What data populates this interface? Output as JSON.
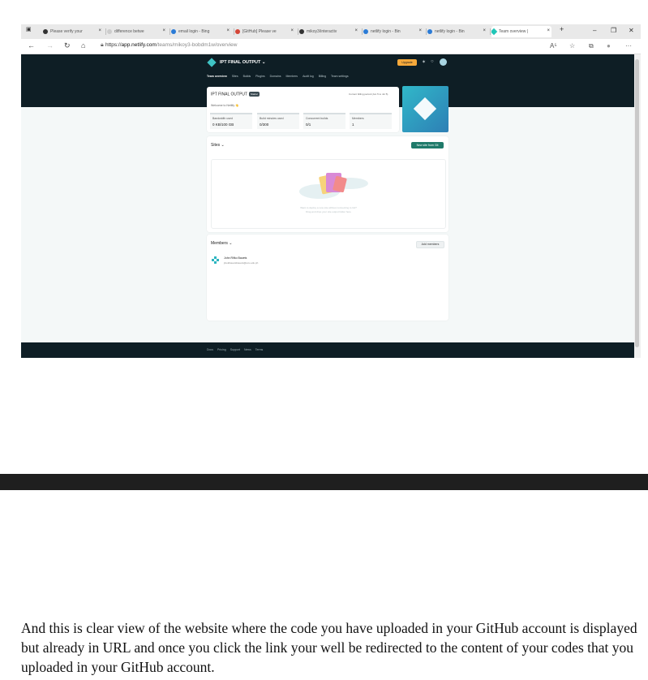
{
  "browser": {
    "tabs": [
      {
        "label": "Please verify your",
        "icon": "github-icon",
        "color": "#333333",
        "active": false
      },
      {
        "label": "difference betwe",
        "icon": "search-icon",
        "color": "#cccccc",
        "active": false
      },
      {
        "label": "email login - Bing",
        "icon": "bing-icon",
        "color": "#2b7bd6",
        "active": false
      },
      {
        "label": "[GitHub] Please ve",
        "icon": "gmail-icon",
        "color": "#d44638",
        "active": false
      },
      {
        "label": "mikoy3/interactiv",
        "icon": "github-icon",
        "color": "#333333",
        "active": false
      },
      {
        "label": "netlify login - Bin",
        "icon": "bing-icon",
        "color": "#2b7bd6",
        "active": false
      },
      {
        "label": "netlify login - Bin",
        "icon": "bing-icon",
        "color": "#2b7bd6",
        "active": false
      },
      {
        "label": "Team overview |",
        "icon": "netlify-icon",
        "color": "#20c6b7",
        "active": true
      }
    ],
    "new_tab": "+",
    "window": {
      "minimize": "–",
      "maximize": "❐",
      "close": "✕"
    },
    "nav": {
      "back": "←",
      "forward": "→",
      "reload": "↻",
      "home": "⌂"
    },
    "url": {
      "prefix": "https://",
      "host": "app.netlify.com",
      "path": "/teams/mikoy3-bobdm1w/overview"
    },
    "toolbar": {
      "read": "A⁵",
      "favorite": "☆",
      "collections": "⧉",
      "profile": "●",
      "more": "···"
    }
  },
  "netlify": {
    "team_name": "IPT FINAL OUTPUT ⌄",
    "upgrade": "Upgrade",
    "header_icons": {
      "notify": "✶",
      "help": "○"
    },
    "nav": [
      "Team overview",
      "Sites",
      "Builds",
      "Plugins",
      "Domains",
      "Members",
      "Audit log",
      "Billing",
      "Team settings"
    ],
    "overview": {
      "title": "IPT FINAL OUTPUT",
      "badge": "Starter",
      "period": "Current billing period (Jun 5 to Jul 5)",
      "welcome": "Welcome to Netlify 👋",
      "stats": [
        {
          "label": "Bandwidth used",
          "value": "0 KB/100 GB"
        },
        {
          "label": "Build minutes used",
          "value": "0/300"
        },
        {
          "label": "Concurrent builds",
          "value": "0/1"
        },
        {
          "label": "Members",
          "value": "1"
        }
      ]
    },
    "sites": {
      "title": "Sites ⌄",
      "button": "New site from Git",
      "empty_line1": "Want to deploy a new site without connecting to Git?",
      "empty_line2": "Drag and drop your site output folder here"
    },
    "members": {
      "title": "Members ⌄",
      "button": "Add members",
      "name": "John Rifko Bauets",
      "email": "jrkokbauetsbauets@ucu.edu.ph"
    },
    "footer": [
      "Docs",
      "Pricing",
      "Support",
      "News",
      "Terms"
    ]
  },
  "caption": "And this is clear  view  of the website where the code you have uploaded in your GitHub account is displayed but already in URL   and once you click the link  your well be redirected to the content of your codes  that you uploaded in your GitHub account."
}
